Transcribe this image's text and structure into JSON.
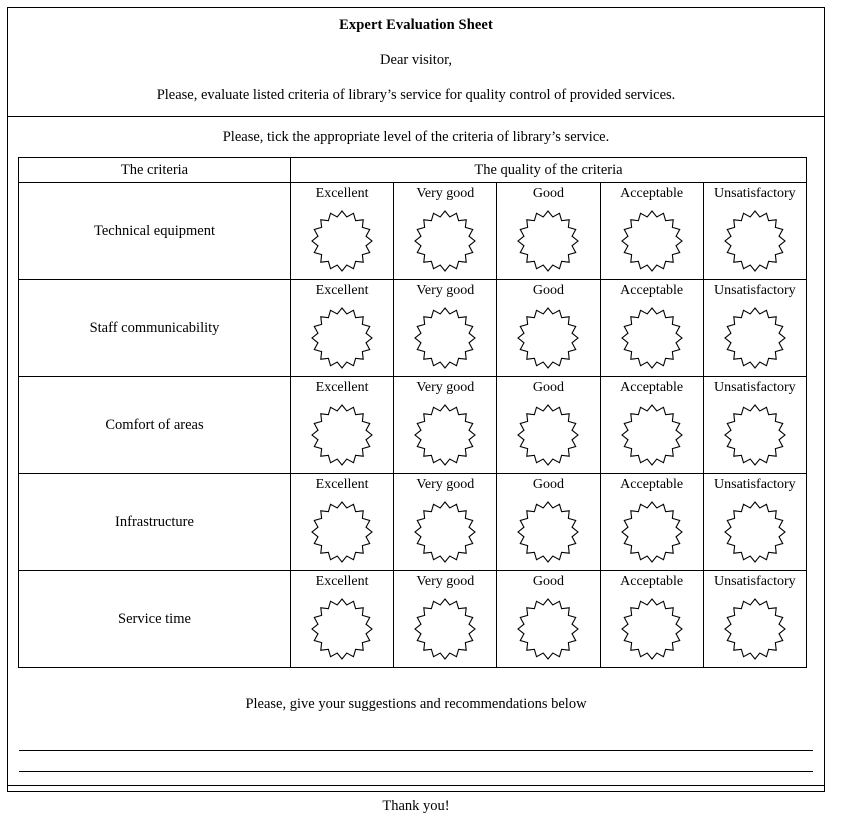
{
  "document": {
    "title": "Expert Evaluation Sheet",
    "salutation": "Dear visitor,",
    "instruction": "Please, evaluate listed criteria of library’s service for quality control of provided services.",
    "tick_instruction": "Please, tick the appropriate level of the criteria of library’s service."
  },
  "table": {
    "criteria_header": "The criteria",
    "quality_header": "The quality of the criteria",
    "levels": [
      "Excellent",
      "Very good",
      "Good",
      "Acceptable",
      "Unsatisfactory"
    ],
    "rows": [
      {
        "criterion": "Technical equipment"
      },
      {
        "criterion": "Staff communicability"
      },
      {
        "criterion": "Comfort of areas"
      },
      {
        "criterion": "Infrastructure"
      },
      {
        "criterion": "Service time"
      }
    ]
  },
  "footer": {
    "suggestions_prompt": "Please, give your suggestions and recommendations below",
    "write_lines": [
      "",
      ""
    ],
    "thanks": "Thank you!"
  },
  "icons": {
    "rating_mark": "starburst-icon"
  },
  "colors": {
    "ink": "#000000",
    "paper": "#ffffff"
  }
}
